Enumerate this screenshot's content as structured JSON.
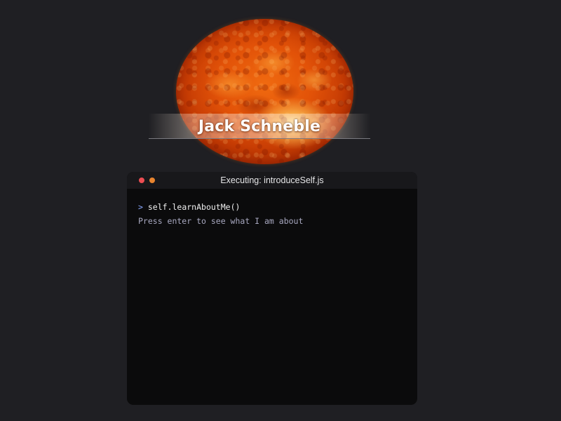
{
  "header": {
    "name": "Jack Schneble"
  },
  "terminal": {
    "title": "Executing: introduceSelf.js",
    "prompt_symbol": ">",
    "command": "self.learnAboutMe()",
    "hint": "Press enter to see what I am about"
  },
  "colors": {
    "background": "#1f1f23",
    "terminal_bg": "#0b0b0c",
    "dot_red": "#ec4d52",
    "dot_orange": "#e8842f",
    "prompt": "#8aa8ff",
    "sun": "#e25208"
  },
  "icons": {
    "sun": "sun-icon",
    "close": "close-dot-icon",
    "minimize": "minimize-dot-icon"
  }
}
